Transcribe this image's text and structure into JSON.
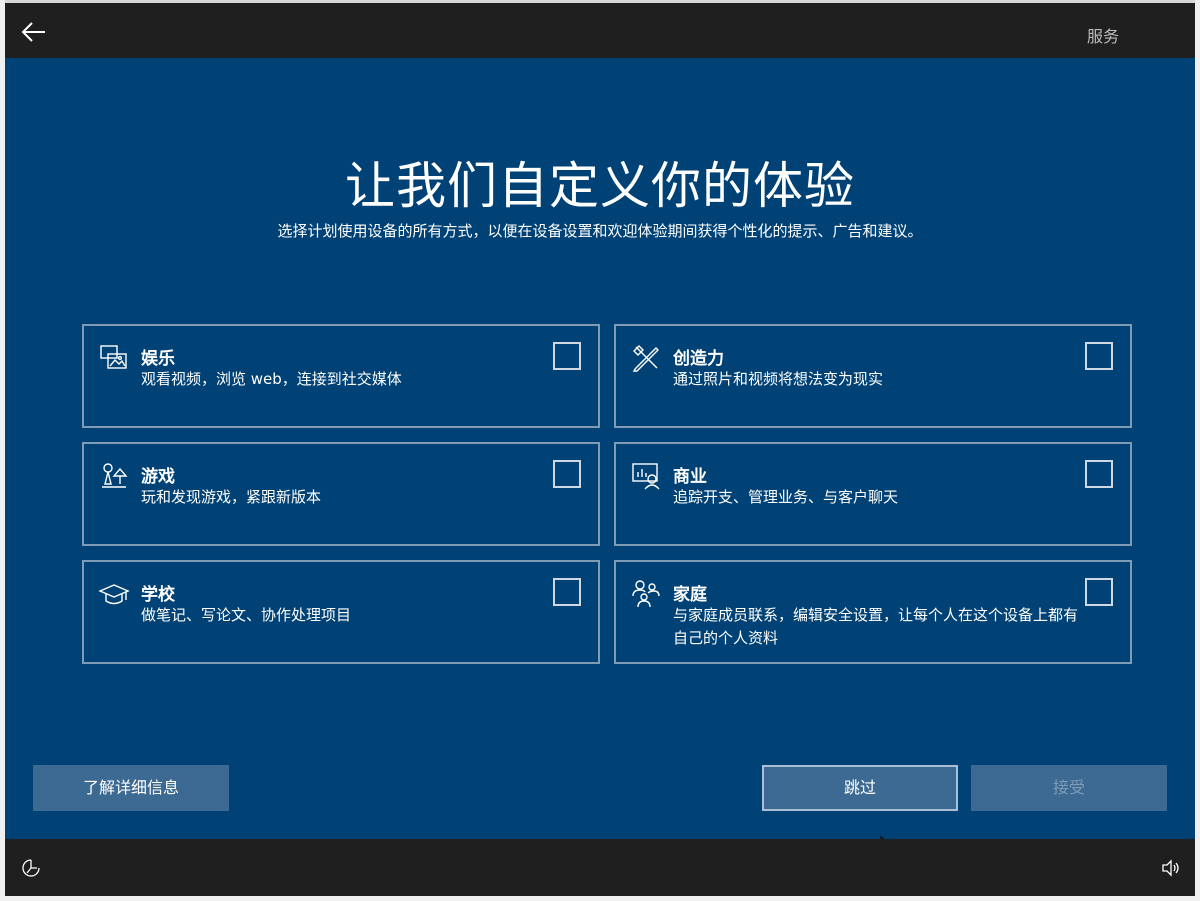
{
  "header": {
    "tab_label": "服务"
  },
  "page": {
    "title": "让我们自定义你的体验",
    "subtitle": "选择计划使用设备的所有方式，以便在设备设置和欢迎体验期间获得个性化的提示、广告和建议。"
  },
  "cards": [
    {
      "icon": "entertainment-icon",
      "title": "娱乐",
      "description": "观看视频，浏览 web，连接到社交媒体",
      "checked": false
    },
    {
      "icon": "creativity-icon",
      "title": "创造力",
      "description": "通过照片和视频将想法变为现实",
      "checked": false
    },
    {
      "icon": "gaming-icon",
      "title": "游戏",
      "description": "玩和发现游戏，紧跟新版本",
      "checked": false
    },
    {
      "icon": "business-icon",
      "title": "商业",
      "description": "追踪开支、管理业务、与客户聊天",
      "checked": false
    },
    {
      "icon": "school-icon",
      "title": "学校",
      "description": "做笔记、写论文、协作处理项目",
      "checked": false
    },
    {
      "icon": "family-icon",
      "title": "家庭",
      "description": "与家庭成员联系，编辑安全设置，让每个人在这个设备上都有自己的个人资料",
      "checked": false
    }
  ],
  "buttons": {
    "learn_more": "了解详细信息",
    "skip": "跳过",
    "accept": "接受"
  },
  "colors": {
    "background": "#004275",
    "chrome": "#1f1f1f",
    "card_border": "#7f9bb5",
    "button": "#3d6a92"
  }
}
